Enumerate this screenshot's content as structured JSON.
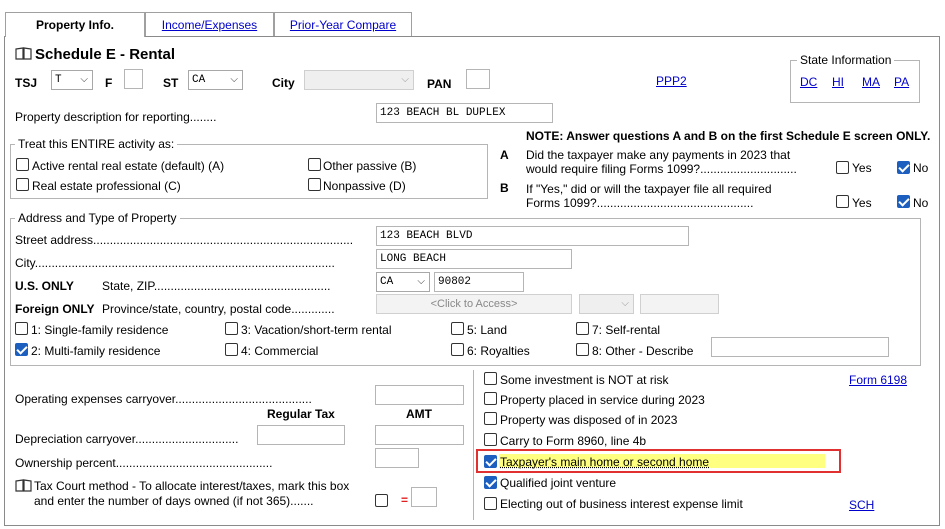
{
  "tabs": [
    {
      "label": "Property Info.",
      "active": true
    },
    {
      "label": "Income/Expenses",
      "active": false
    },
    {
      "label": "Prior-Year Compare",
      "active": false
    }
  ],
  "header": {
    "title": "Schedule E - Rental",
    "tsj_label": "TSJ",
    "tsj_value": "T",
    "f_label": "F",
    "st_label": "ST",
    "st_value": "CA",
    "city_label": "City",
    "pan_label": "PAN",
    "ppp2_link": "PPP2"
  },
  "state_info": {
    "title": "State Information",
    "links": [
      "DC",
      "HI",
      "MA",
      "PA"
    ]
  },
  "property_description": {
    "label": "Property description for reporting",
    "value": "123 BEACH BL DUPLEX"
  },
  "treat_activity": {
    "title": "Treat this ENTIRE activity as:",
    "options": [
      {
        "label": "Active rental real estate (default) (A)",
        "checked": false
      },
      {
        "label": "Real estate professional (C)",
        "checked": false
      },
      {
        "label": "Other passive (B)",
        "checked": false
      },
      {
        "label": "Nonpassive (D)",
        "checked": false
      }
    ]
  },
  "note": {
    "text": "NOTE: Answer questions A and B on the first Schedule E screen ONLY.",
    "qa_letter": "A",
    "qa_line1": "Did the taxpayer make any payments in 2023 that",
    "qa_line2": "would require filing Forms 1099?",
    "qb_letter": "B",
    "qb_line1": "If \"Yes,\" did or will the taxpayer file all required",
    "qb_line2": "Forms 1099?",
    "yes_label": "Yes",
    "no_label": "No",
    "qa_yes": false,
    "qa_no": true,
    "qb_yes": false,
    "qb_no": true
  },
  "address": {
    "title": "Address and Type of Property",
    "street_label": "Street address",
    "street_value": "123 BEACH BLVD",
    "city_label": "City",
    "city_value": "LONG BEACH",
    "us_only_label": "U.S. ONLY",
    "state_zip_label": "State, ZIP",
    "state_value": "CA",
    "zip_value": "90802",
    "foreign_only_label": "Foreign ONLY",
    "foreign_label": "Province/state, country, postal code",
    "click_to_access": "<Click to Access>",
    "property_types": [
      {
        "label": "1: Single-family residence",
        "checked": false
      },
      {
        "label": "2: Multi-family residence",
        "checked": true
      },
      {
        "label": "3: Vacation/short-term rental",
        "checked": false
      },
      {
        "label": "4: Commercial",
        "checked": false
      },
      {
        "label": "5: Land",
        "checked": false
      },
      {
        "label": "6: Royalties",
        "checked": false
      },
      {
        "label": "7: Self-rental",
        "checked": false
      },
      {
        "label": "8: Other - Describe",
        "checked": false
      }
    ]
  },
  "carryover": {
    "operating_label": "Operating expenses carryover",
    "regular_tax_label": "Regular Tax",
    "amt_label": "AMT",
    "depreciation_label": "Depreciation carryover",
    "ownership_label": "Ownership percent",
    "tax_court_line1": "Tax Court method - To allocate interest/taxes, mark this box",
    "tax_court_line2": "and enter the number of days owned (if not 365)",
    "equals": "="
  },
  "right_options": {
    "items": [
      {
        "label": "Some investment is NOT at risk",
        "checked": false
      },
      {
        "label": "Property placed in service during 2023",
        "checked": false
      },
      {
        "label": "Property was disposed of in 2023",
        "checked": false
      },
      {
        "label": "Carry to Form 8960, line 4b",
        "checked": false
      },
      {
        "label": "Taxpayer's main home or second home",
        "checked": true
      },
      {
        "label": "Qualified joint venture",
        "checked": true
      },
      {
        "label": "Electing out of business interest expense limit",
        "checked": false
      }
    ],
    "form_6198_link": "Form 6198",
    "sch_link": "SCH"
  }
}
